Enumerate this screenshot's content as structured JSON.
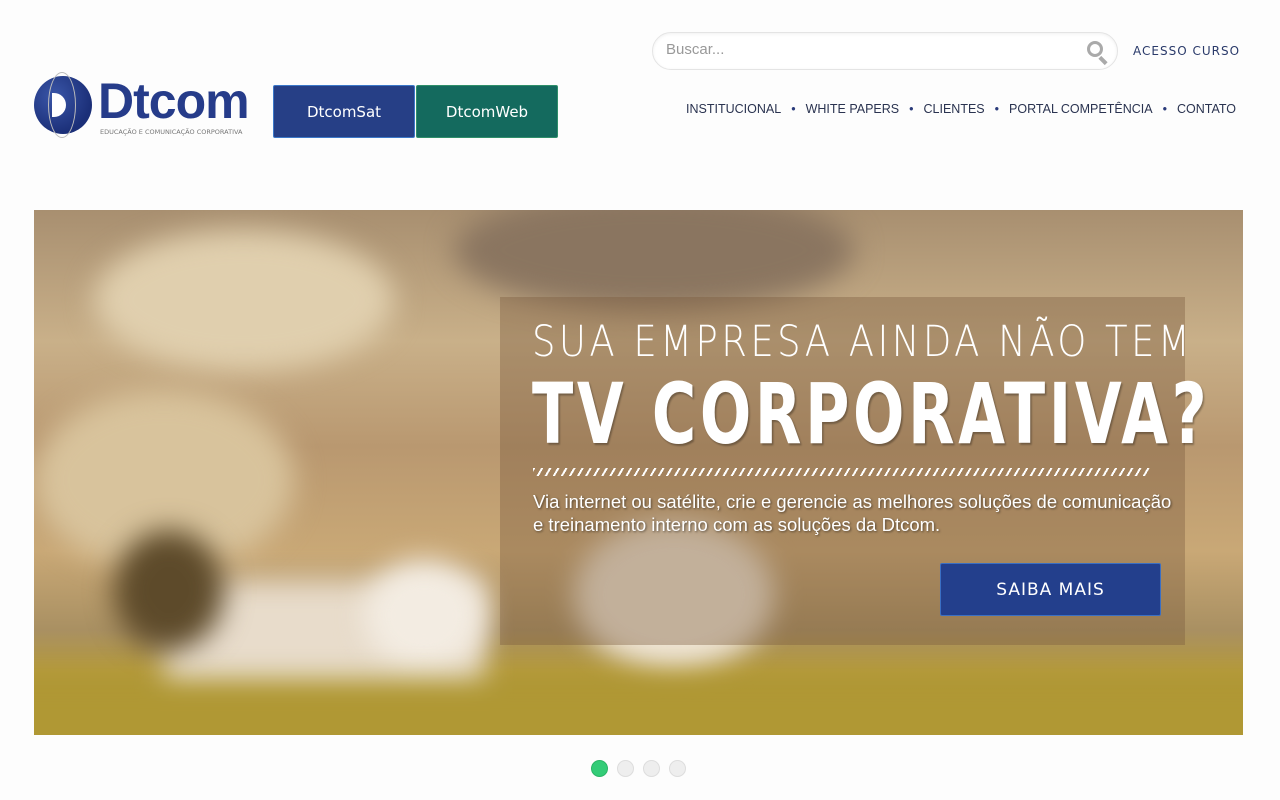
{
  "logo": {
    "name": "Dtcom",
    "tagline": "EDUCAÇÃO E COMUNICAÇÃO CORPORATIVA"
  },
  "header": {
    "dtcomsat": "DtcomSat",
    "dtcomweb": "DtcomWeb",
    "search_placeholder": "Buscar...",
    "acesso": "ACESSO CURSO",
    "nav": [
      "INSTITUCIONAL",
      "WHITE PAPERS",
      "CLIENTES",
      "PORTAL COMPETÊNCIA",
      "CONTATO"
    ],
    "nav_separator": "•"
  },
  "hero": {
    "line1": "SUA EMPRESA AINDA NÃO TEM",
    "line2": "TV CORPORATIVA?",
    "description": "Via internet ou satélite, crie e gerencie as melhores soluções de comunicação e treinamento interno com as soluções da Dtcom.",
    "cta": "SAIBA MAIS"
  },
  "slider": {
    "count": 4,
    "active": 1
  },
  "colors": {
    "brand_blue": "#263f86",
    "brand_green": "#146a5e",
    "active_dot": "#33cc77"
  }
}
